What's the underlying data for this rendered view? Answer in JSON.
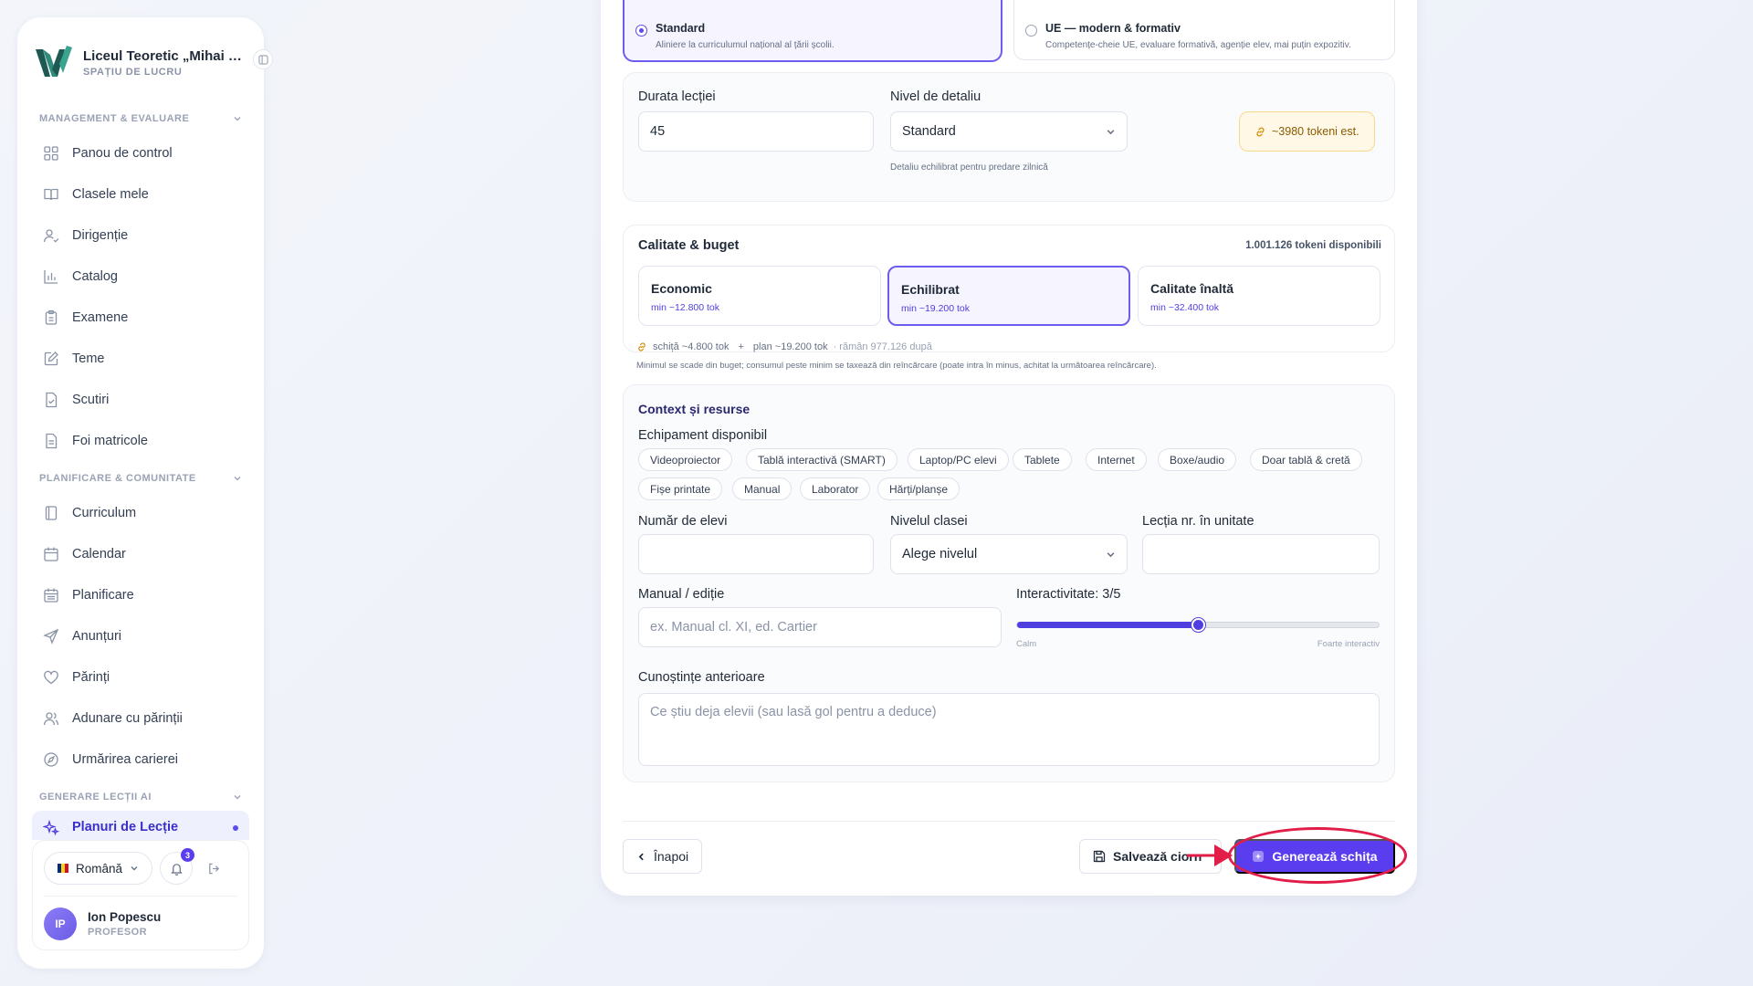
{
  "brand": {
    "title": "Liceul Teoretic „Mihai Emi…",
    "subtitle": "SPAȚIU DE LUCRU"
  },
  "sidebar": {
    "sections": [
      {
        "label": "MANAGEMENT & EVALUARE",
        "items": [
          {
            "label": "Panou de control",
            "icon": "dashboard-icon"
          },
          {
            "label": "Clasele mele",
            "icon": "book-open-icon"
          },
          {
            "label": "Dirigenție",
            "icon": "user-check-icon"
          },
          {
            "label": "Catalog",
            "icon": "bar-chart-icon"
          },
          {
            "label": "Examene",
            "icon": "clipboard-icon"
          },
          {
            "label": "Teme",
            "icon": "edit-note-icon"
          },
          {
            "label": "Scutiri",
            "icon": "file-check-icon"
          },
          {
            "label": "Foi matricole",
            "icon": "file-text-icon"
          }
        ]
      },
      {
        "label": "PLANIFICARE & COMUNITATE",
        "items": [
          {
            "label": "Curriculum",
            "icon": "book-icon"
          },
          {
            "label": "Calendar",
            "icon": "calendar-icon"
          },
          {
            "label": "Planificare",
            "icon": "calendar-grid-icon"
          },
          {
            "label": "Anunțuri",
            "icon": "send-icon"
          },
          {
            "label": "Părinți",
            "icon": "heart-icon"
          },
          {
            "label": "Adunare cu părinții",
            "icon": "users-icon"
          },
          {
            "label": "Urmărirea carierei",
            "icon": "compass-icon"
          }
        ]
      },
      {
        "label": "GENERARE LECȚII AI",
        "items": [
          {
            "label": "Planuri de Lecție",
            "icon": "sparkles-icon",
            "active": true
          }
        ]
      }
    ],
    "footer": {
      "language": "Română",
      "notifications_count": "3",
      "user_initials": "IP",
      "user_name": "Ion Popescu",
      "user_role": "PROFESOR"
    }
  },
  "approaches": [
    {
      "title": "Standard",
      "desc": "Aliniere la curriculumul național al țării școlii.",
      "selected": true
    },
    {
      "title": "UE — modern & formativ",
      "desc": "Competențe-cheie UE, evaluare formativă, agenție elev, mai puțin expozitiv.",
      "selected": false
    }
  ],
  "lesson": {
    "duration_label": "Durata lecției",
    "duration_value": "45",
    "detail_label": "Nivel de detaliu",
    "detail_value": "Standard",
    "detail_hint": "Detaliu echilibrat pentru predare zilnică",
    "token_estimate": "~3980 tokeni est."
  },
  "quality": {
    "title": "Calitate & buget",
    "available": "1.001.126 tokeni disponibili",
    "tiers": [
      {
        "name": "Economic",
        "min": "min ~12.800 tok",
        "selected": false
      },
      {
        "name": "Echilibrat",
        "min": "min ~19.200 tok",
        "selected": true
      },
      {
        "name": "Calitate înaltă",
        "min": "min ~32.400 tok",
        "selected": false
      }
    ],
    "breakdown_draft": "schiță ~4.800 tok",
    "breakdown_plus": "+",
    "breakdown_plan": "plan ~19.200 tok",
    "breakdown_remaining": "· rămân 977.126 după",
    "note": "Minimul se scade din buget; consumul peste minim se taxează din reîncărcare (poate intra în minus, achitat la următoarea reîncărcare)."
  },
  "context": {
    "title": "Context și resurse",
    "equipment_label": "Echipament disponibil",
    "equipment": [
      "Videoproiector",
      "Tablă interactivă (SMART)",
      "Laptop/PC elevi",
      "Tablete",
      "Internet",
      "Boxe/audio",
      "Doar tablă & cretă",
      "Fișe printate",
      "Manual",
      "Laborator",
      "Hărți/planșe"
    ],
    "students_label": "Număr de elevi",
    "students_value": "",
    "class_level_label": "Nivelul clasei",
    "class_level_value": "Alege nivelul",
    "lesson_no_label": "Lecția nr. în unitate",
    "lesson_no_value": "",
    "manual_label": "Manual / ediție",
    "manual_placeholder": "ex. Manual cl. XI, ed. Cartier",
    "interactivity_label": "Interactivitate: 3/5",
    "interactivity_value": 3,
    "interactivity_max": 5,
    "interactivity_min_label": "Calm",
    "interactivity_max_label": "Foarte interactiv",
    "prior_label": "Cunoștințe anterioare",
    "prior_placeholder": "Ce știu deja elevii (sau lasă gol pentru a deduce)"
  },
  "actions": {
    "back": "Înapoi",
    "save": "Salvează ciorn",
    "generate": "Generează schița"
  },
  "colors": {
    "accent": "#5b3df0",
    "annotation": "#e11d48"
  }
}
